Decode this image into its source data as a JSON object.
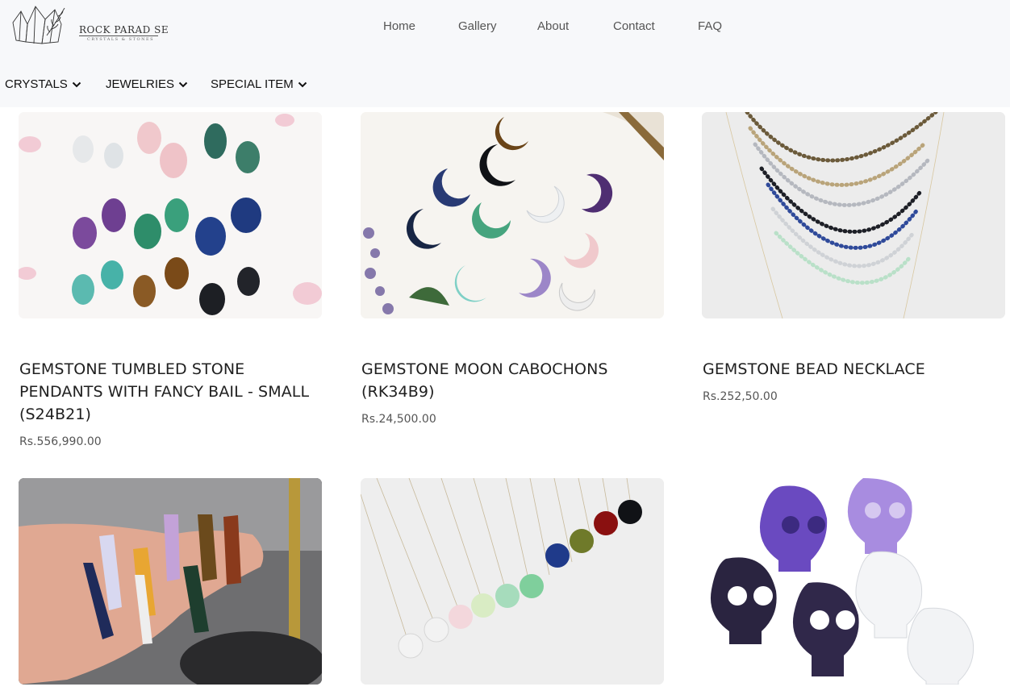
{
  "brand": {
    "name": "ROCK PARAD SE",
    "tagline": "CRYSTALS & STONES"
  },
  "topnav": [
    "Home",
    "Gallery",
    "About",
    "Contact",
    "FAQ"
  ],
  "categories": [
    "CRYSTALS",
    "JEWELRIES",
    "SPECIAL ITEM"
  ],
  "products": [
    {
      "title": "GEMSTONE TUMBLED STONE PENDANTS WITH FANCY BAIL - SMALL (S24B21)",
      "price": "Rs.556,990.00",
      "image": "tumbled-pendants"
    },
    {
      "title": "GEMSTONE MOON CABOCHONS (RK34B9)",
      "price": "Rs.24,500.00",
      "image": "moon-cabochons"
    },
    {
      "title": "GEMSTONE BEAD NECKLACE",
      "price": "Rs.252,50.00",
      "image": "bead-necklace"
    },
    {
      "title": "",
      "price": "",
      "image": "point-pendants"
    },
    {
      "title": "",
      "price": "",
      "image": "faceted-pendants"
    },
    {
      "title": "",
      "price": "",
      "image": "crystal-skulls"
    }
  ],
  "colors": {
    "header_bg": "#f7f8fa",
    "nav_text": "#555555",
    "title_text": "#1f1f1f"
  }
}
